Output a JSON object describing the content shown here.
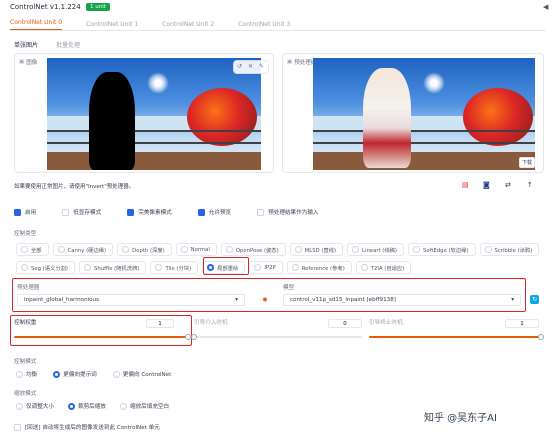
{
  "header": {
    "title": "ControlNet v1.1.224",
    "badge": "1 unit",
    "collapse_icon": "caret-down-icon"
  },
  "unit_tabs": [
    "ControlNet Unit 0",
    "ControlNet Unit 1",
    "ControlNet Unit 2",
    "ControlNet Unit 3"
  ],
  "sub_tabs": [
    "单张图片",
    "批量处理"
  ],
  "image_panel": {
    "label": "图像"
  },
  "preview_panel": {
    "label": "预处理结果预览",
    "corner_button": "下载"
  },
  "hint": "如果要使用正常图片，请使用\"Invert\"预处理器。",
  "options": [
    {
      "label": "启用",
      "checked": true
    },
    {
      "label": "低显存模式",
      "checked": false
    },
    {
      "label": "完美像素模式",
      "checked": true
    },
    {
      "label": "允许预览",
      "checked": true
    },
    {
      "label": "预处理结果作为输入",
      "checked": false
    }
  ],
  "control_type": {
    "label": "控制类型",
    "selected": "局部重绘",
    "row1": [
      "全部",
      "Canny (硬边缘)",
      "Depth (深度)",
      "Normal",
      "OpenPose (姿态)",
      "MLSD (直线)",
      "Lineart (线稿)",
      "SoftEdge (软边缘)",
      "Scribble (涂鸦)"
    ],
    "row2": [
      "Seg (语义分割)",
      "Shuffle (随机洗牌)",
      "Tile (分块)",
      "局部重绘",
      "IP2P",
      "Reference (参考)",
      "T2IA (自适应)"
    ]
  },
  "preprocessor": {
    "label": "预处理器",
    "value": "inpaint_global_harmonious"
  },
  "model": {
    "label": "模型",
    "value": "control_v11p_sd15_inpaint [ebff9138]"
  },
  "sliders": [
    {
      "label": "控制权重",
      "value": "1",
      "fraction": 1.0
    },
    {
      "label": "引导介入时机",
      "value": "0",
      "fraction": 0.0
    },
    {
      "label": "引导终止时机",
      "value": "1",
      "fraction": 1.0
    }
  ],
  "control_mode": {
    "label": "控制模式",
    "options": [
      "均衡",
      "更偏向提示词",
      "更偏向 ControlNet"
    ],
    "selected": "更偏向提示词"
  },
  "resize_mode": {
    "label": "缩放模式",
    "options": [
      "仅调整大小",
      "裁剪后缩放",
      "缩放后填充空白"
    ],
    "selected": "裁剪后缩放"
  },
  "loopback": {
    "label": "[回送] 自动将生成后的图像发送到此 ControlNet 单元",
    "checked": false
  },
  "watermark": "知乎 @吴东子AI",
  "colors": {
    "accent": "#ea580c",
    "primary": "#2563eb",
    "highlight": "#dc2626",
    "badge": "#16a34a"
  }
}
